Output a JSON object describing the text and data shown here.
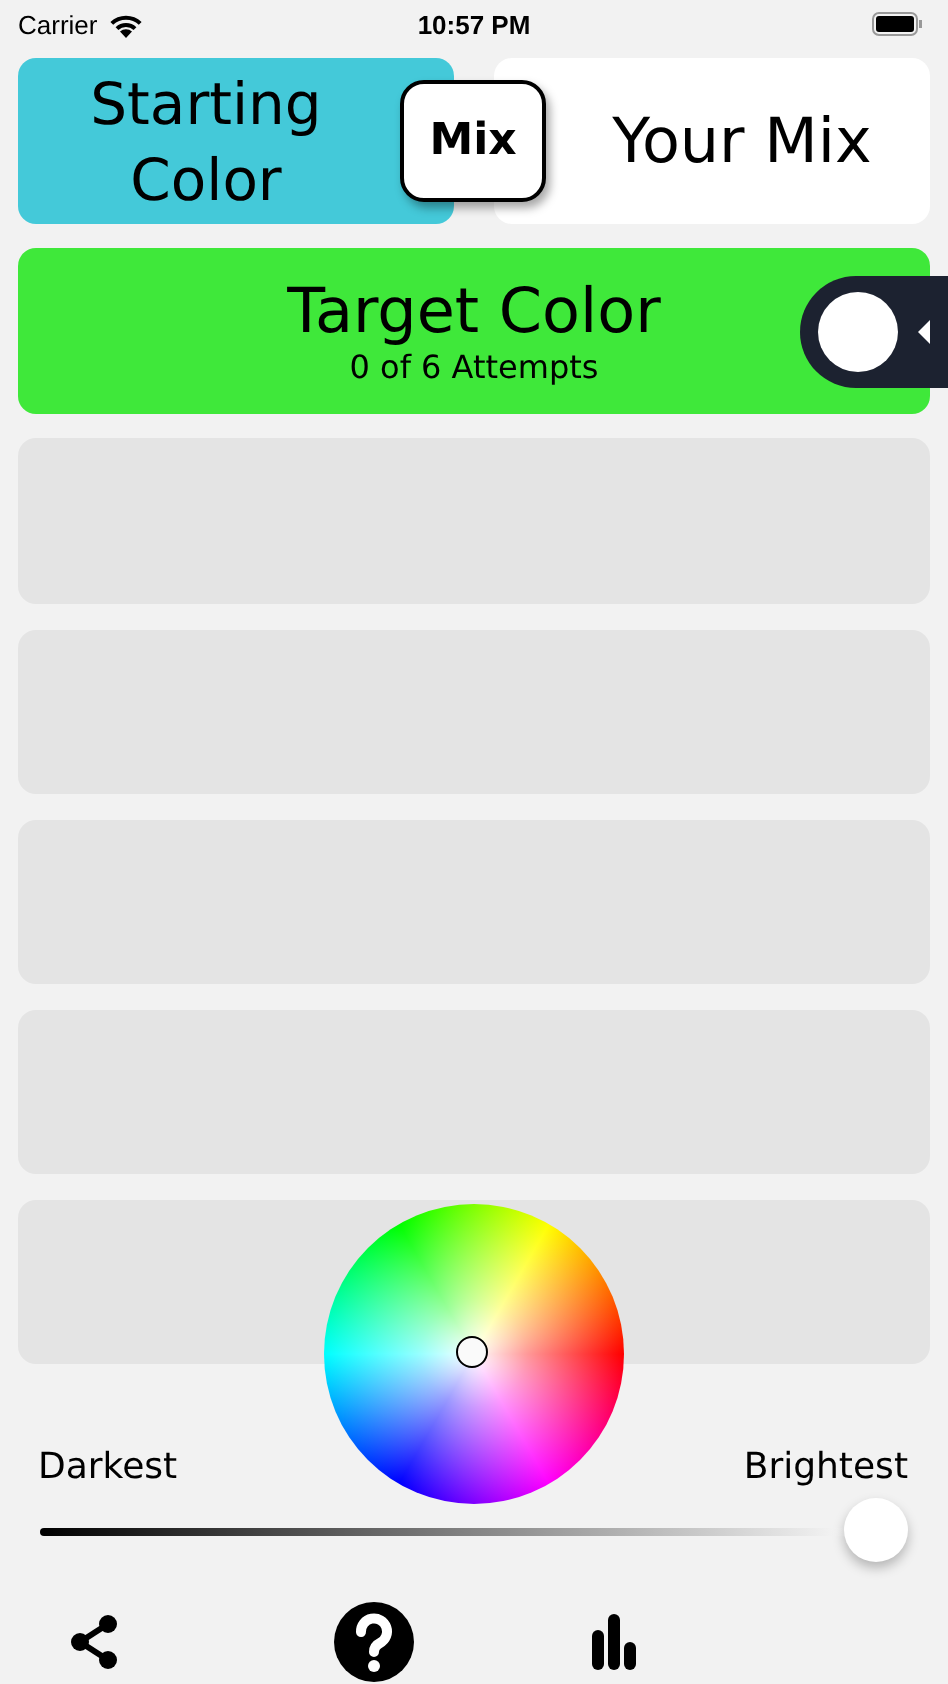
{
  "status_bar": {
    "carrier": "Carrier",
    "time": "10:57 PM"
  },
  "mix_row": {
    "starting": {
      "label": "Starting Color",
      "color": "#44c9d9"
    },
    "mix_button": "Mix",
    "your_mix": {
      "label": "Your Mix",
      "color": "#ffffff"
    }
  },
  "target": {
    "title": "Target Color",
    "attempts": "0 of 6 Attempts",
    "color": "#3fe83a"
  },
  "guess_rows": [
    {
      "kind": "empty"
    },
    {
      "kind": "empty"
    },
    {
      "kind": "empty"
    },
    {
      "kind": "empty"
    },
    {
      "kind": "empty"
    }
  ],
  "brightness": {
    "min_label": "Darkest",
    "max_label": "Brightest",
    "level": 1
  },
  "toolbar": [
    {
      "kind": "share"
    },
    {
      "kind": "help"
    },
    {
      "kind": "stats"
    }
  ]
}
